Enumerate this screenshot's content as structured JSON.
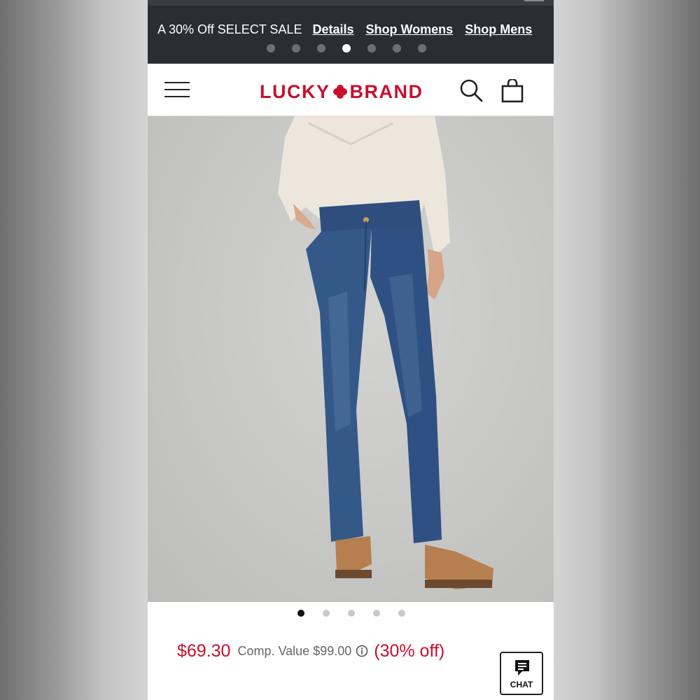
{
  "promo": {
    "text": "A 30% Off SELECT SALE",
    "details_link": "Details",
    "shop_womens_link": "Shop Womens",
    "shop_mens_link": "Shop Mens",
    "slide_count": 7,
    "active_slide": 4
  },
  "header": {
    "logo_left": "LUCKY",
    "logo_right": "BRAND",
    "menu_icon": "hamburger-menu-icon",
    "search_icon": "search-icon",
    "bag_icon": "shopping-bag-icon"
  },
  "product": {
    "image_icon": "product-photo-bootcut-jeans",
    "image_count": 5,
    "active_image": 1,
    "price": "$69.30",
    "comp_value": "Comp. Value $99.00",
    "discount": "(30% off)"
  },
  "chat": {
    "label": "CHAT",
    "icon": "chat-bubble-icon"
  },
  "colors": {
    "brand_red": "#c8102e",
    "promo_bg": "#2b2d2f"
  }
}
